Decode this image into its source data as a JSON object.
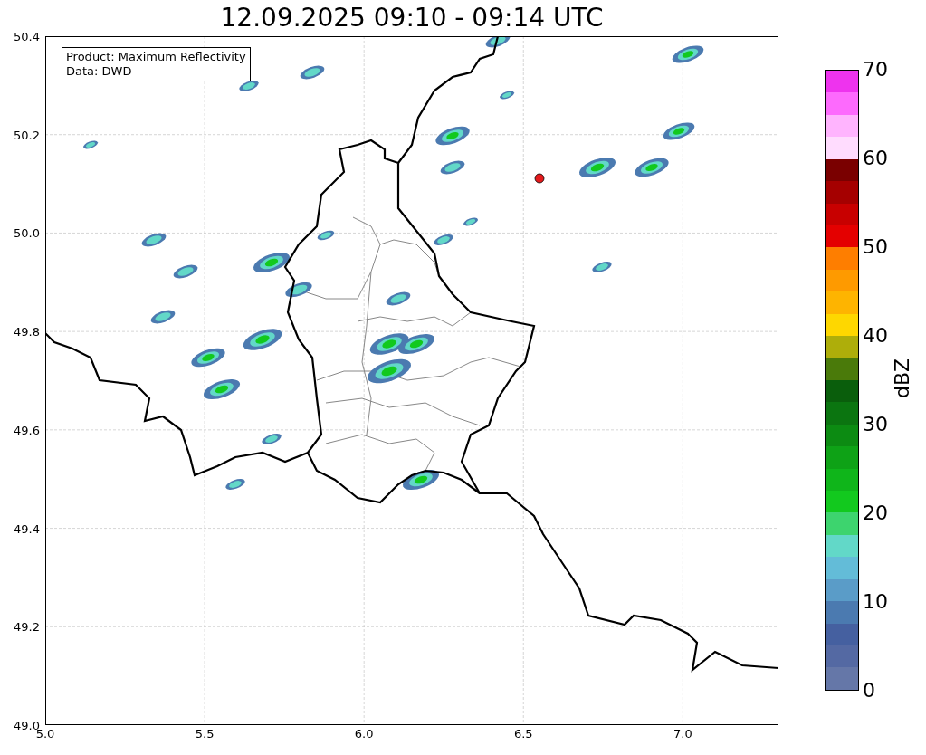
{
  "title": "12.09.2025 09:10 - 09:14 UTC",
  "legend": [
    "Product: Maximum Reflectivity",
    "Data: DWD"
  ],
  "map": {
    "x_ticks": [
      "5.0",
      "5.5",
      "6.0",
      "6.5",
      "7.0"
    ],
    "y_ticks": [
      "50.4",
      "50.2",
      "50.0",
      "49.8",
      "49.6",
      "49.4",
      "49.2",
      "49.0"
    ]
  },
  "colorbar": {
    "label": "dBZ",
    "ticks": [
      "70",
      "60",
      "50",
      "40",
      "30",
      "20",
      "10",
      "0"
    ],
    "segments": [
      {
        "color": "#ee33ee"
      },
      {
        "color": "#fd6afd"
      },
      {
        "color": "#ffb4fe"
      },
      {
        "color": "#ffdcfe"
      },
      {
        "color": "#7a0000"
      },
      {
        "color": "#a50000"
      },
      {
        "color": "#c80000"
      },
      {
        "color": "#e40000"
      },
      {
        "color": "#fe7e00"
      },
      {
        "color": "#fe9a00"
      },
      {
        "color": "#feb400"
      },
      {
        "color": "#fed700"
      },
      {
        "color": "#aeae0a"
      },
      {
        "color": "#4a7a0a"
      },
      {
        "color": "#0a5e0c"
      },
      {
        "color": "#0b7510"
      },
      {
        "color": "#0c8b12"
      },
      {
        "color": "#0ea216"
      },
      {
        "color": "#0fb51a"
      },
      {
        "color": "#12c91e"
      },
      {
        "color": "#3dd46e"
      },
      {
        "color": "#62d8c8"
      },
      {
        "color": "#63bcd8"
      },
      {
        "color": "#5a9cc8"
      },
      {
        "color": "#4b7ab0"
      },
      {
        "color": "#4560a0"
      },
      {
        "color": "#5469a3"
      },
      {
        "color": "#6577a8"
      }
    ]
  }
}
